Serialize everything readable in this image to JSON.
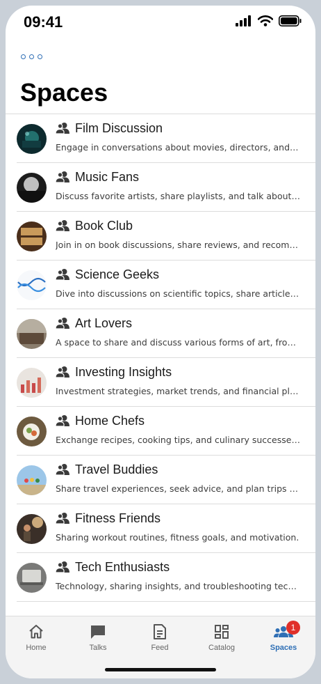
{
  "status": {
    "time": "09:41"
  },
  "header": {
    "title": "Spaces"
  },
  "spaces": [
    {
      "name": "Film Discussion",
      "description": "Engage in conversations about movies, directors, and cinema."
    },
    {
      "name": "Music Fans",
      "description": "Discuss favorite artists, share playlists, and talk about music."
    },
    {
      "name": "Book Club",
      "description": "Join in on book discussions, share reviews, and recommendations."
    },
    {
      "name": "Science Geeks",
      "description": "Dive into discussions on scientific topics, share articles, and more."
    },
    {
      "name": "Art Lovers",
      "description": "A space to share and discuss various forms of art, from painting to sculpture."
    },
    {
      "name": "Investing Insights",
      "description": "Investment strategies, market trends, and financial planning."
    },
    {
      "name": "Home Chefs",
      "description": "Exchange recipes, cooking tips, and culinary successes and failures."
    },
    {
      "name": "Travel Buddies",
      "description": "Share travel experiences, seek advice, and plan trips with others."
    },
    {
      "name": "Fitness Friends",
      "description": "Sharing workout routines, fitness goals, and motivation."
    },
    {
      "name": "Tech Enthusiasts",
      "description": "Technology, sharing insights, and troubleshooting tech issues."
    }
  ],
  "tabs": [
    {
      "label": "Home",
      "icon": "home-icon"
    },
    {
      "label": "Talks",
      "icon": "chat-icon"
    },
    {
      "label": "Feed",
      "icon": "feed-icon"
    },
    {
      "label": "Catalog",
      "icon": "catalog-icon"
    },
    {
      "label": "Spaces",
      "icon": "people-icon",
      "badge": "1"
    }
  ],
  "colors": {
    "accent": "#2f6fb5",
    "badge": "#e0302a"
  }
}
